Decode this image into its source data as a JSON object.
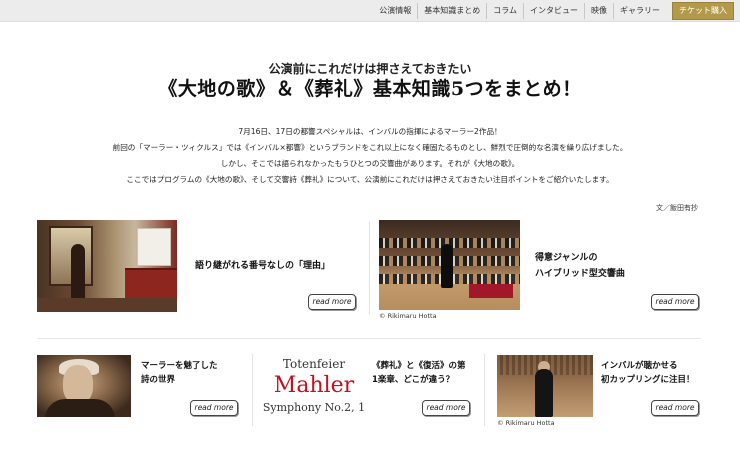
{
  "nav": {
    "items": [
      "公演情報",
      "基本知識まとめ",
      "コラム",
      "インタビュー",
      "映像",
      "ギャラリー"
    ],
    "ticket": "チケット購入"
  },
  "header": {
    "subtitle": "公演前にこれだけは押さえておきたい",
    "title": "《大地の歌》＆《葬礼》基本知識5つをまとめ！"
  },
  "intro": [
    "7月16日、17日の都響スペシャルは、インバルの指揮によるマーラー2作品！",
    "前回の「マーラー・ツィクルス」では《インバル×都響》というブランドをこれ以上になく確固たるものとし、鮮烈で圧倒的な名演を繰り広げました。",
    "しかし、そこでは語られなかったもうひとつの交響曲があります。それが《大地の歌》。",
    "ここではプログラムの《大地の歌》、そして交響詩《葬礼》について、公演前にこれだけは押さえておきたい注目ポイントをご紹介いたします。"
  ],
  "author": "文／飯田有抄",
  "cards": {
    "c1": {
      "label": "語り継がれる番号なしの「理由」",
      "more": "read more"
    },
    "c2": {
      "label_line1": "得意ジャンルの",
      "label_line2": "ハイブリッド型交響曲",
      "more": "read more",
      "credit": "© Rikimaru Hotta"
    },
    "c3": {
      "label_line1": "マーラーを魅了した",
      "label_line2": "詩の世界",
      "more": "read more"
    },
    "c4": {
      "label_line1": "《葬礼》と《復活》の第",
      "label_line2": "1楽章、どこが違う？",
      "more": "read more",
      "graphic_t1": "Totenfeier",
      "graphic_t2": "Mahler",
      "graphic_t3": "Symphony No.2, 1"
    },
    "c5": {
      "label_line1": "インバルが聴かせる",
      "label_line2": "初カップリングに注目！",
      "more": "read more",
      "credit": "© Rikimaru Hotta"
    }
  }
}
